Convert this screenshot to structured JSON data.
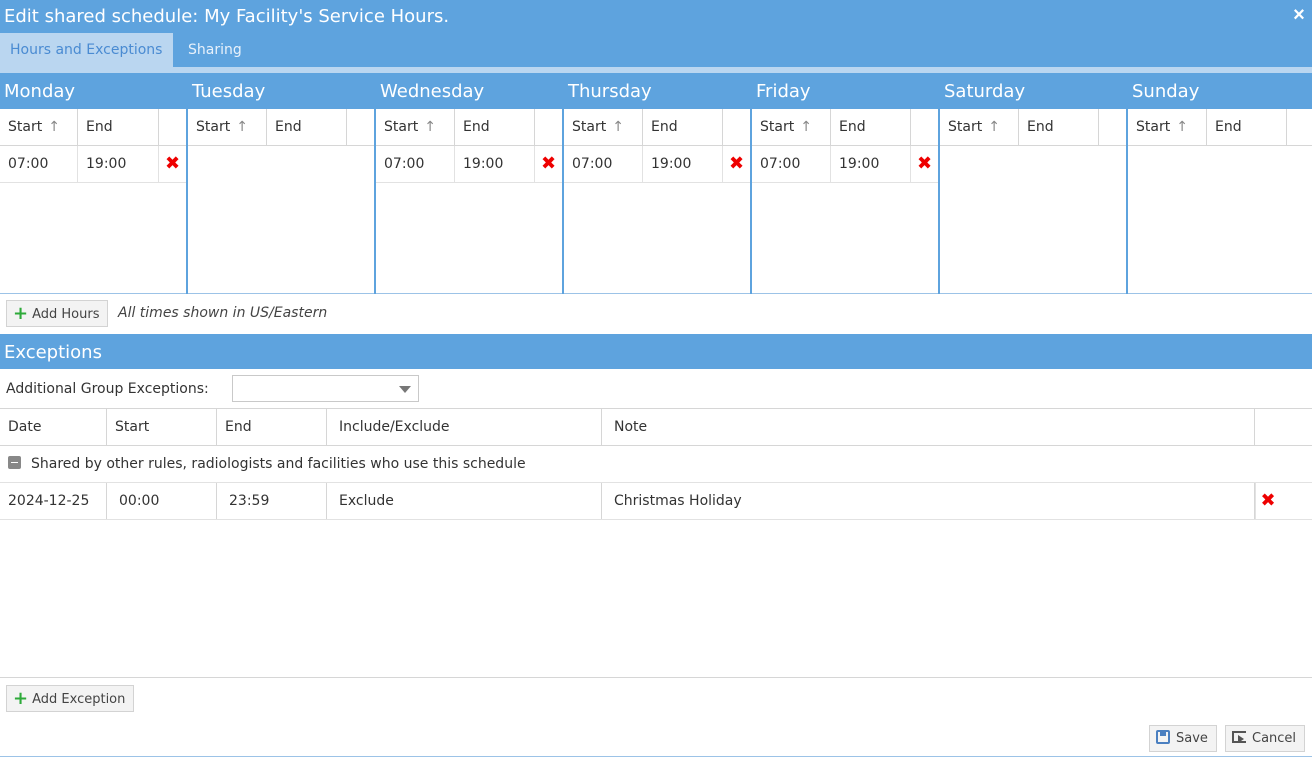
{
  "window": {
    "title": "Edit shared schedule: My Facility's Service Hours.",
    "close_icon": "×"
  },
  "tabs": [
    {
      "label": "Hours and Exceptions",
      "active": true
    },
    {
      "label": "Sharing",
      "active": false
    }
  ],
  "hours": {
    "columns": {
      "start": "Start",
      "end": "End",
      "sort_icon": "↑"
    },
    "delete_icon": "✖",
    "days": [
      {
        "name": "Monday",
        "start": "07:00",
        "end": "19:00"
      },
      {
        "name": "Tuesday"
      },
      {
        "name": "Wednesday",
        "start": "07:00",
        "end": "19:00"
      },
      {
        "name": "Thursday",
        "start": "07:00",
        "end": "19:00"
      },
      {
        "name": "Friday",
        "start": "07:00",
        "end": "19:00"
      },
      {
        "name": "Saturday"
      },
      {
        "name": "Sunday"
      }
    ],
    "add_button": "Add Hours",
    "timezone_note": "All times shown in US/Eastern"
  },
  "exceptions": {
    "title": "Exceptions",
    "group_label": "Additional Group Exceptions:",
    "group_value": "",
    "columns": [
      "Date",
      "Start",
      "End",
      "Include/Exclude",
      "Note"
    ],
    "group_row": "Shared by other rules, radiologists and facilities who use this schedule",
    "rows": [
      {
        "date": "2024-12-25",
        "start": "00:00",
        "end": "23:59",
        "mode": "Exclude",
        "note": "Christmas Holiday"
      }
    ],
    "add_button": "Add Exception"
  },
  "footer": {
    "save": "Save",
    "cancel": "Cancel"
  },
  "colors": {
    "header": "#5ea3de",
    "tab_active": "#bad6f0",
    "delete": "#e00000",
    "add": "#2eaa3a"
  }
}
